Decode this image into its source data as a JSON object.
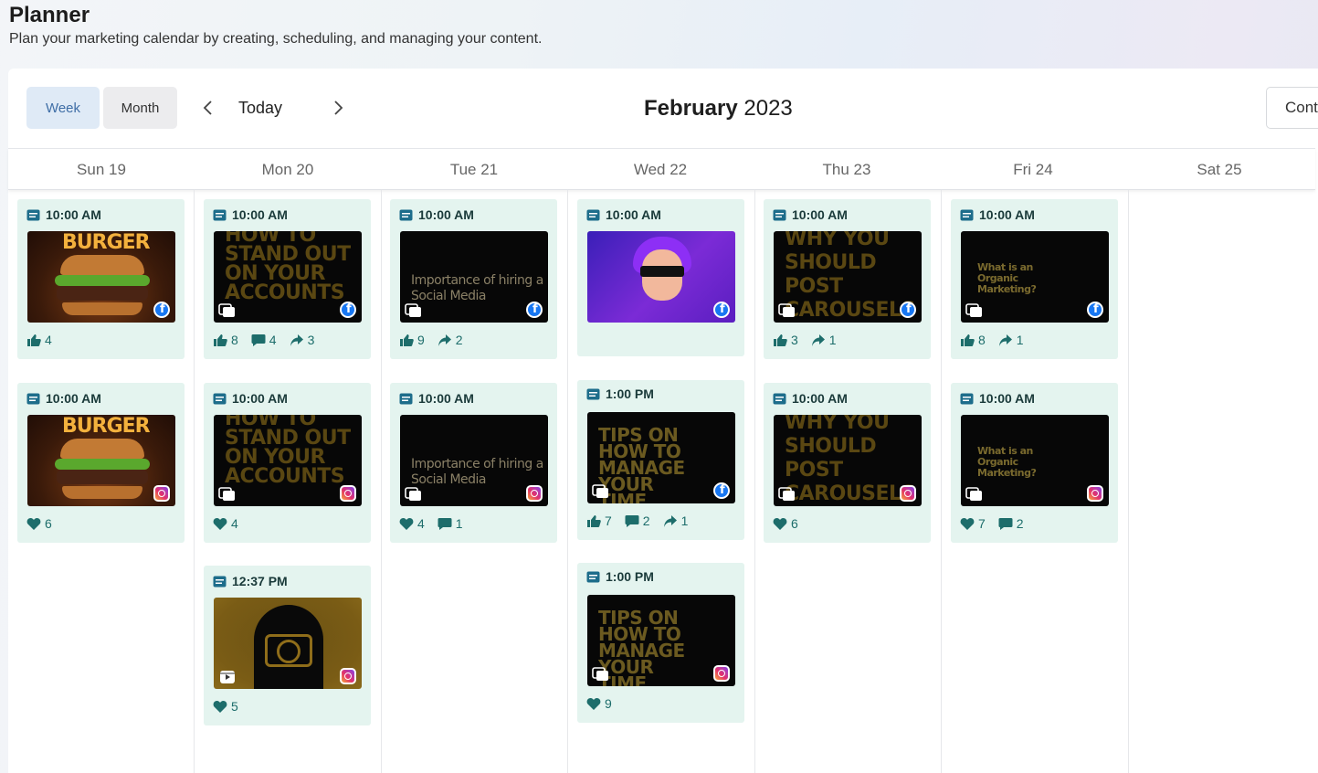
{
  "header": {
    "title": "Planner",
    "subtitle": "Plan your marketing calendar by creating, scheduling, and managing your content."
  },
  "toolbar": {
    "week_label": "Week",
    "month_label": "Month",
    "today_label": "Today",
    "month_name": "February",
    "year": "2023",
    "cont_label": "Cont"
  },
  "days": [
    "Sun 19",
    "Mon 20",
    "Tue 21",
    "Wed 22",
    "Thu 23",
    "Fri 24",
    "Sat 25"
  ],
  "colors": {
    "accent": "#3f6ea6",
    "card_bg": "#e4f4ef",
    "metric": "#1d6d6b",
    "facebook": "#1877f2"
  },
  "posts": {
    "sun_fb": {
      "time": "10:00 AM",
      "image_text": "BURGER",
      "platform": "facebook-icon",
      "likes": "4"
    },
    "sun_ig": {
      "time": "10:00 AM",
      "image_text": "BURGER",
      "platform": "instagram-icon",
      "hearts": "6"
    },
    "mon_fb": {
      "time": "10:00 AM",
      "image_text": "HOW TO STAND OUT ON YOUR ACCOUNTS",
      "platform": "facebook-icon",
      "likes": "8",
      "comments": "4",
      "shares": "3"
    },
    "mon_ig": {
      "time": "10:00 AM",
      "image_text": "HOW TO STAND OUT ON YOUR ACCOUNTS",
      "platform": "instagram-icon",
      "hearts": "4"
    },
    "mon_reel": {
      "time": "12:37 PM",
      "platform": "instagram-icon",
      "hearts": "5"
    },
    "tue_fb": {
      "time": "10:00 AM",
      "image_text": "Importance of hiring a Social Media",
      "platform": "facebook-icon",
      "likes": "9",
      "shares": "2"
    },
    "tue_ig": {
      "time": "10:00 AM",
      "image_text": "Importance of hiring a Social Media",
      "platform": "instagram-icon",
      "hearts": "4",
      "comments": "1"
    },
    "wed_fb": {
      "time": "10:00 AM",
      "platform": "facebook-icon"
    },
    "wed_fb2": {
      "time": "1:00 PM",
      "image_text": "TIPS ON HOW TO MANAGE YOUR TIME",
      "platform": "facebook-icon",
      "likes": "7",
      "comments": "2",
      "shares": "1"
    },
    "wed_ig": {
      "time": "1:00 PM",
      "image_text": "TIPS ON HOW TO MANAGE YOUR TIME",
      "platform": "instagram-icon",
      "hearts": "9"
    },
    "thu_fb": {
      "time": "10:00 AM",
      "image_text": "WHY YOU SHOULD POST CAROUSELS",
      "platform": "facebook-icon",
      "likes": "3",
      "shares": "1"
    },
    "thu_ig": {
      "time": "10:00 AM",
      "image_text": "WHY YOU SHOULD POST CAROUSELS",
      "platform": "instagram-icon",
      "hearts": "6"
    },
    "fri_fb": {
      "time": "10:00 AM",
      "image_text": "What is an Organic Marketing?",
      "platform": "facebook-icon",
      "likes": "8",
      "shares": "1"
    },
    "fri_ig": {
      "time": "10:00 AM",
      "image_text": "What is an Organic Marketing?",
      "platform": "instagram-icon",
      "hearts": "7",
      "comments": "2"
    }
  }
}
